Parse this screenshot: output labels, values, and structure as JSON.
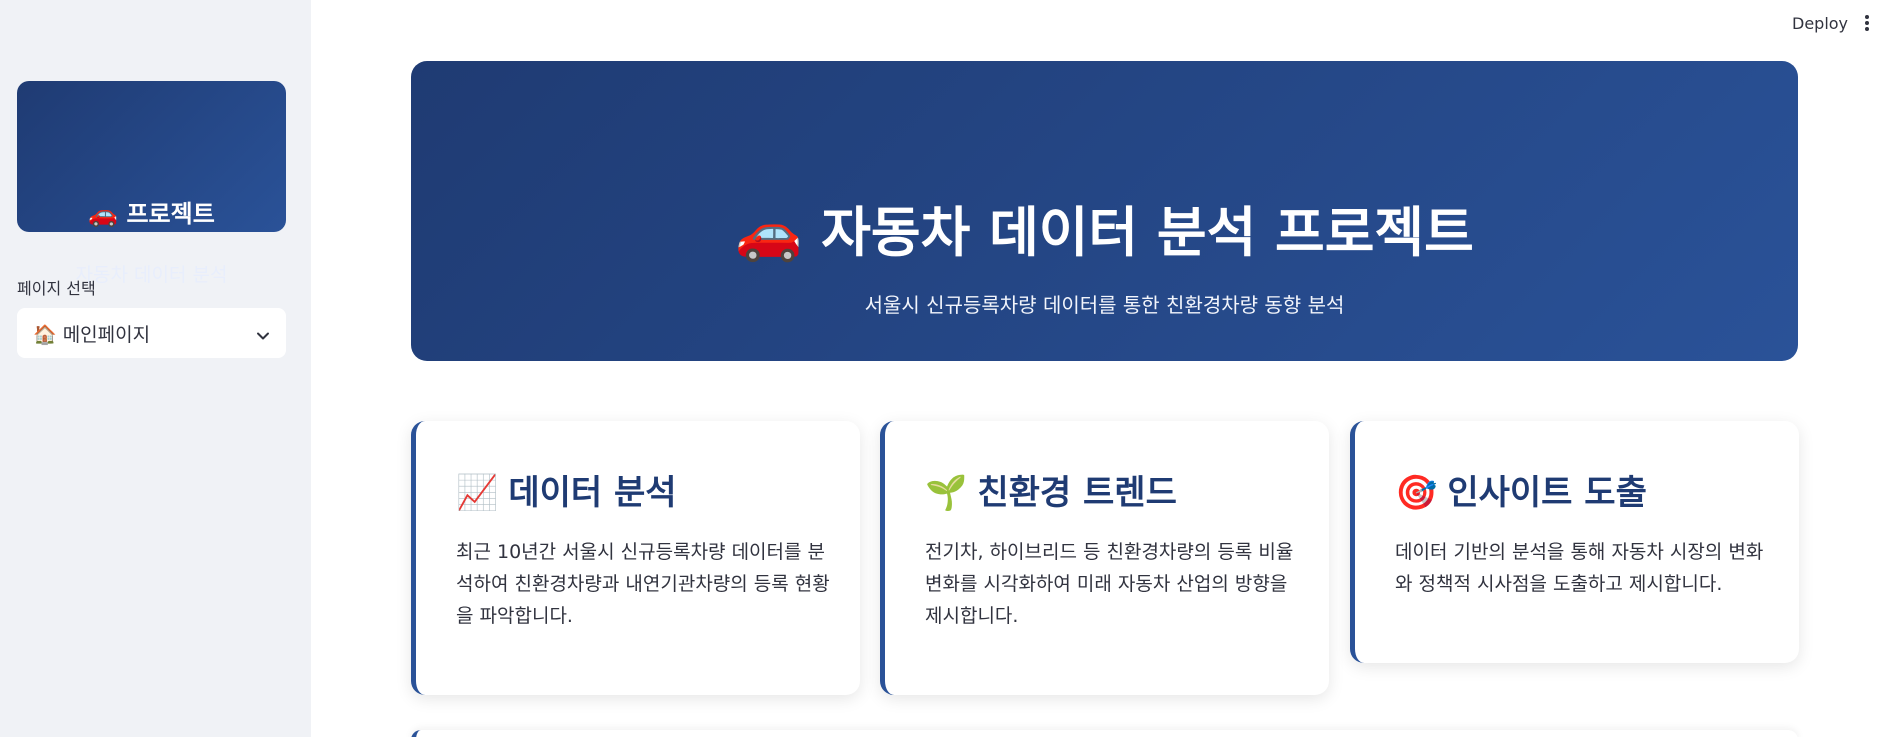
{
  "sidebar": {
    "card_title": "🚗 프로젝트",
    "card_subtitle": "자동차 데이터 분석",
    "select_label": "페이지 선택",
    "select_value": "🏠 메인페이지"
  },
  "header": {
    "deploy_label": "Deploy"
  },
  "hero": {
    "title": "🚗 자동차 데이터 분석 프로젝트",
    "subtitle": "서울시 신규등록차량 데이터를 통한 친환경차량 동향 분석"
  },
  "cards": [
    {
      "emoji": "📈",
      "title": "데이터 분석",
      "body": "최근 10년간 서울시 신규등록차량 데이터를 분석하여 친환경차량과 내연기관차량의 등록 현황을 파악합니다."
    },
    {
      "emoji": "🌱",
      "title": "친환경 트렌드",
      "body": "전기차, 하이브리드 등 친환경차량의 등록 비율 변화를 시각화하여 미래 자동차 산업의 방향을 제시합니다."
    },
    {
      "emoji": "🎯",
      "title": "인사이트 도출",
      "body": "데이터 기반의 분석을 통해 자동차 시장의 변화와 정책적 시사점을 도출하고 제시합니다."
    }
  ],
  "colors": {
    "primary": "#1f3b73",
    "accent": "#2a5298",
    "sidebar_bg": "#f0f2f6"
  }
}
